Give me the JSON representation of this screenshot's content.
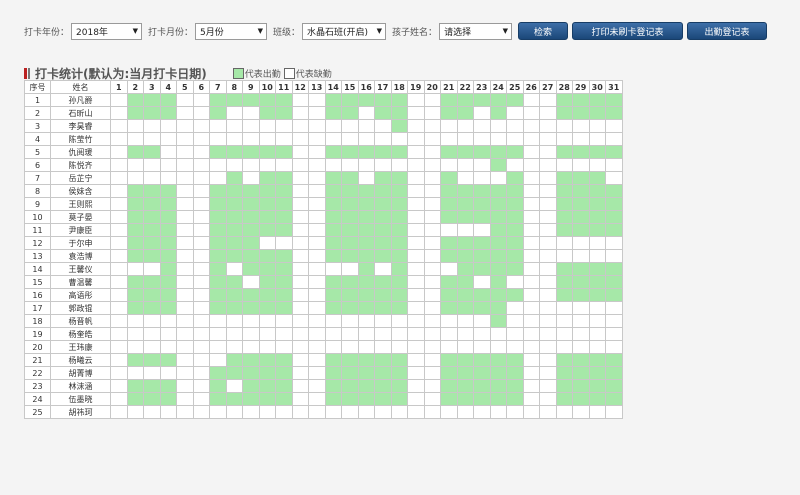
{
  "filters": {
    "year_label": "打卡年份：",
    "year_value": "2018年",
    "month_label": "打卡月份：",
    "month_value": "5月份",
    "class_label": "班级：",
    "class_value": "水晶石班(开启)",
    "child_label": "孩子姓名：",
    "child_value": "请选择",
    "search_button": "检索",
    "print_button": "打印未刷卡登记表",
    "register_button": "出勤登记表"
  },
  "section": {
    "title": "打卡统计(默认为:当月打卡日期)",
    "legend_present": "代表出勤",
    "legend_absent": "代表缺勤"
  },
  "colors": {
    "present": "#a6e8a8",
    "absent": "#ffffff",
    "button": "#1f4f86"
  },
  "table": {
    "header_index": "序号",
    "header_name": "姓名",
    "days": [
      "1",
      "2",
      "3",
      "4",
      "5",
      "6",
      "7",
      "8",
      "9",
      "10",
      "11",
      "12",
      "13",
      "14",
      "15",
      "16",
      "17",
      "18",
      "19",
      "20",
      "21",
      "22",
      "23",
      "24",
      "25",
      "26",
      "27",
      "28",
      "29",
      "30",
      "31"
    ],
    "rows": [
      {
        "no": "1",
        "name": "孙凡爵",
        "att": [
          2,
          3,
          4,
          7,
          8,
          9,
          10,
          11,
          14,
          15,
          16,
          17,
          18,
          21,
          22,
          23,
          24,
          25,
          28,
          29,
          30,
          31
        ]
      },
      {
        "no": "2",
        "name": "石昕山",
        "att": [
          2,
          3,
          4,
          7,
          10,
          11,
          14,
          15,
          17,
          18,
          21,
          22,
          24,
          28,
          29,
          30,
          31
        ]
      },
      {
        "no": "3",
        "name": "李昊睿",
        "att": [
          18
        ]
      },
      {
        "no": "4",
        "name": "陈莹竹",
        "att": []
      },
      {
        "no": "5",
        "name": "仇阅瑗",
        "att": [
          2,
          3,
          7,
          8,
          9,
          10,
          11,
          14,
          15,
          16,
          17,
          18,
          21,
          22,
          23,
          24,
          25,
          28,
          29,
          30,
          31
        ]
      },
      {
        "no": "6",
        "name": "陈悦齐",
        "att": [
          24
        ]
      },
      {
        "no": "7",
        "name": "岳芷宁",
        "att": [
          8,
          10,
          11,
          14,
          15,
          17,
          18,
          21,
          25,
          28,
          29,
          30
        ]
      },
      {
        "no": "8",
        "name": "侯妹含",
        "att": [
          2,
          3,
          4,
          7,
          8,
          9,
          10,
          11,
          14,
          15,
          16,
          17,
          18,
          21,
          22,
          23,
          24,
          25,
          28,
          29,
          30,
          31
        ]
      },
      {
        "no": "9",
        "name": "王则熙",
        "att": [
          2,
          3,
          4,
          7,
          8,
          9,
          10,
          11,
          14,
          15,
          16,
          17,
          18,
          21,
          22,
          23,
          24,
          25,
          28,
          29,
          30,
          31
        ]
      },
      {
        "no": "10",
        "name": "莫子晏",
        "att": [
          2,
          3,
          4,
          7,
          8,
          9,
          10,
          11,
          14,
          15,
          16,
          17,
          18,
          21,
          22,
          23,
          24,
          25,
          28,
          29,
          30,
          31
        ]
      },
      {
        "no": "11",
        "name": "尹康臣",
        "att": [
          2,
          3,
          4,
          7,
          8,
          9,
          10,
          11,
          14,
          15,
          16,
          17,
          18,
          24,
          25,
          28,
          29,
          30,
          31
        ]
      },
      {
        "no": "12",
        "name": "于尔申",
        "att": [
          2,
          3,
          4,
          7,
          8,
          9,
          14,
          15,
          16,
          17,
          18,
          21,
          22,
          23,
          24,
          25
        ]
      },
      {
        "no": "13",
        "name": "袁浩博",
        "att": [
          2,
          3,
          4,
          7,
          8,
          9,
          10,
          11,
          14,
          15,
          16,
          17,
          18,
          21,
          22,
          23,
          24,
          25
        ]
      },
      {
        "no": "14",
        "name": "王馨仪",
        "att": [
          4,
          7,
          9,
          10,
          11,
          16,
          18,
          22,
          23,
          24,
          25,
          28,
          29,
          30,
          31
        ]
      },
      {
        "no": "15",
        "name": "曹温馨",
        "att": [
          2,
          3,
          4,
          7,
          8,
          10,
          11,
          14,
          15,
          16,
          17,
          18,
          21,
          22,
          24,
          28,
          29,
          30,
          31
        ]
      },
      {
        "no": "16",
        "name": "高语彤",
        "att": [
          2,
          3,
          4,
          7,
          8,
          9,
          10,
          11,
          14,
          15,
          16,
          17,
          18,
          21,
          22,
          23,
          24,
          25,
          28,
          29,
          30,
          31
        ]
      },
      {
        "no": "17",
        "name": "郭政锟",
        "att": [
          2,
          3,
          4,
          7,
          8,
          9,
          10,
          11,
          14,
          15,
          16,
          17,
          18,
          21,
          22,
          23,
          24
        ]
      },
      {
        "no": "18",
        "name": "杨晋帆",
        "att": [
          24
        ]
      },
      {
        "no": "19",
        "name": "杨奎皓",
        "att": []
      },
      {
        "no": "20",
        "name": "王玮康",
        "att": []
      },
      {
        "no": "21",
        "name": "杨曦云",
        "att": [
          2,
          3,
          4,
          8,
          9,
          10,
          11,
          14,
          15,
          16,
          17,
          18,
          21,
          22,
          23,
          24,
          25,
          28,
          29,
          30,
          31
        ]
      },
      {
        "no": "22",
        "name": "胡菁博",
        "att": [
          7,
          8,
          9,
          10,
          11,
          14,
          15,
          16,
          17,
          18,
          21,
          22,
          23,
          24,
          25,
          28,
          29,
          30,
          31
        ]
      },
      {
        "no": "23",
        "name": "林沫涵",
        "att": [
          2,
          3,
          4,
          7,
          9,
          10,
          11,
          14,
          15,
          16,
          17,
          18,
          21,
          22,
          23,
          24,
          25,
          28,
          29,
          30,
          31
        ]
      },
      {
        "no": "24",
        "name": "伍墨晓",
        "att": [
          2,
          3,
          4,
          7,
          8,
          9,
          10,
          11,
          14,
          15,
          16,
          17,
          18,
          21,
          22,
          23,
          24,
          25,
          28,
          29,
          30,
          31
        ]
      },
      {
        "no": "25",
        "name": "胡祎珂",
        "att": []
      }
    ]
  }
}
